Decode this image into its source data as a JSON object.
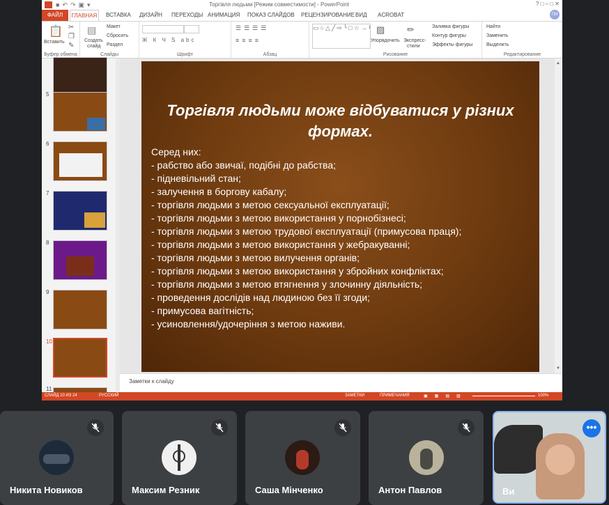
{
  "window": {
    "title": "Торгівля людьми [Режим совместимости] - PowerPoint",
    "restore_label": "ПИ"
  },
  "tabs": {
    "file": "ФАЙЛ",
    "active": "ГЛАВНАЯ",
    "items": [
      "ВСТАВКА",
      "ДИЗАЙН",
      "ПЕРЕХОДЫ",
      "АНИМАЦИЯ",
      "ПОКАЗ СЛАЙДОВ",
      "РЕЦЕНЗИРОВАНИЕ",
      "ВИД",
      "ACROBAT"
    ]
  },
  "ribbon": {
    "paste": "Вставить",
    "new_slide_1": "Создать",
    "new_slide_2": "слайд",
    "layout": "Макет",
    "reset": "Сбросить",
    "section": "Раздел",
    "arrange_1": "Упорядочить",
    "quick_styles_1": "Экспресс-",
    "quick_styles_2": "стили",
    "fill": "Заливка фигуры",
    "outline": "Контур фигуры",
    "effects": "Эффекты фигуры",
    "find": "Найти",
    "replace": "Заменить",
    "select": "Выделить",
    "groups": {
      "clipboard": "Буфер обмена",
      "slides": "Слайды",
      "font": "Шрифт",
      "paragraph": "Абзац",
      "drawing": "Рисование",
      "editing": "Редактирование"
    }
  },
  "thumbnails": [
    {
      "num": "5"
    },
    {
      "num": "6"
    },
    {
      "num": "7"
    },
    {
      "num": "8"
    },
    {
      "num": "9"
    },
    {
      "num": "10"
    },
    {
      "num": "11"
    }
  ],
  "slide": {
    "title": "Торгівля людьми може відбуватися у різних формах.",
    "lines": [
      "Серед них:",
      "- рабство або звичаї, подібні до рабства;",
      "- підневільний стан;",
      "- залучення в боргову кабалу;",
      "- торгівля людьми з метою сексуальної експлуатації;",
      "- торгівля людьми з метою використання у порнобізнесі;",
      "- торгівля людьми з метою трудової експлуатації (примусова праця);",
      "- торгівля людьми з метою використання у жебракуванні;",
      "- торгівля людьми з метою вилучення органів;",
      "- торгівля людьми з метою використання у збройних конфліктах;",
      "- торгівля людьми з метою втягнення у злочинну діяльність;",
      "- проведення дослідів над людиною без її згоди;",
      "- примусова вагітність;",
      "- усиновлення/удочеріння з метою наживи."
    ]
  },
  "notes": {
    "placeholder": "Заметки к слайду"
  },
  "statusbar": {
    "slide": "СЛАЙД 10 ИЗ 24",
    "language": "РУССКИЙ",
    "notes": "ЗАМЕТКИ",
    "comments": "ПРИМЕЧАНИЯ",
    "zoom": "100%"
  },
  "participants": [
    {
      "name": "Никита Новиков",
      "muted": true
    },
    {
      "name": "Максим Резник",
      "muted": true
    },
    {
      "name": "Саша Мінченко",
      "muted": true
    },
    {
      "name": "Антон Павлов",
      "muted": true
    }
  ],
  "self": {
    "name": "Ви"
  }
}
